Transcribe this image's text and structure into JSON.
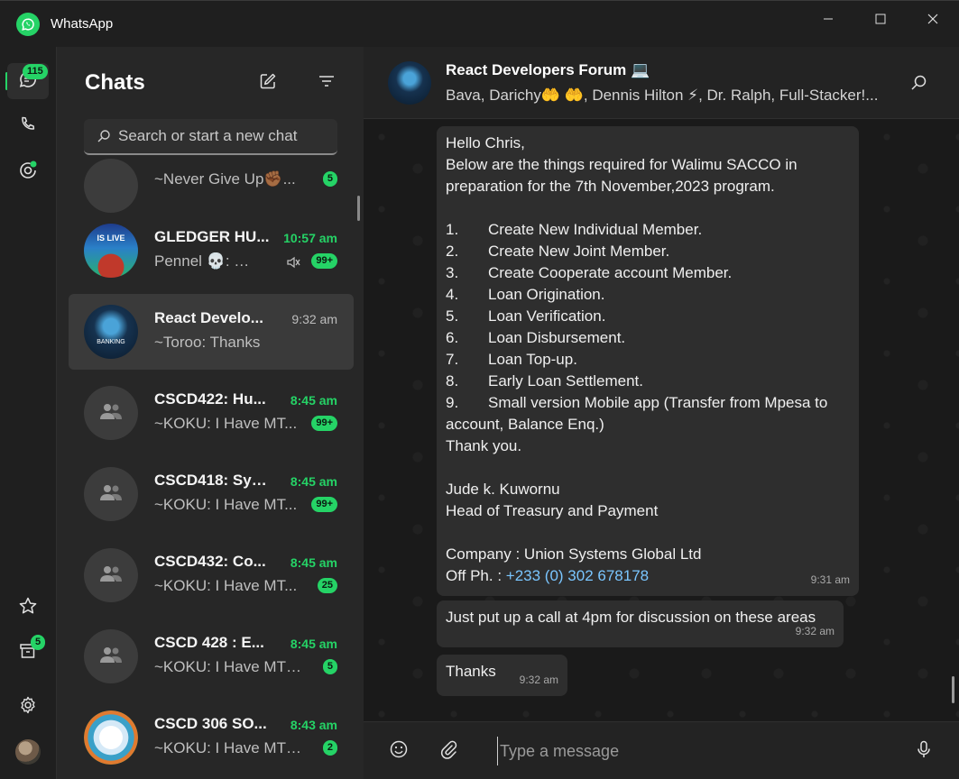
{
  "app": {
    "title": "WhatsApp"
  },
  "rail": {
    "chats_badge": "115",
    "archived_badge": "5"
  },
  "chatlist": {
    "title": "Chats",
    "search_placeholder": "Search or start a new chat",
    "items": [
      {
        "name": "",
        "time": "",
        "preview": "~Never Give Up✊🏾...",
        "badge": "5",
        "unread": true
      },
      {
        "name": "GLEDGER HU...",
        "time": "10:57 am",
        "preview": "Pennel 💀: 🫡...",
        "badge": "99+",
        "unread": true,
        "muted": true
      },
      {
        "name": "React Develo...",
        "time": "9:32 am",
        "preview": "~Toroo: Thanks",
        "badge": "",
        "unread": false
      },
      {
        "name": "CSCD422: Hu...",
        "time": "8:45 am",
        "preview": "~KOKU: I Have MT...",
        "badge": "99+",
        "unread": true
      },
      {
        "name": "CSCD418: Sys...",
        "time": "8:45 am",
        "preview": "~KOKU: I Have MT...",
        "badge": "99+",
        "unread": true
      },
      {
        "name": "CSCD432: Co...",
        "time": "8:45 am",
        "preview": "~KOKU: I Have MT...",
        "badge": "25",
        "unread": true
      },
      {
        "name": "CSCD 428 : E...",
        "time": "8:45 am",
        "preview": "~KOKU: I Have MTN,...",
        "badge": "5",
        "unread": true
      },
      {
        "name": "CSCD 306 SO...",
        "time": "8:43 am",
        "preview": "~KOKU: I Have MTN,...",
        "badge": "2",
        "unread": true
      }
    ],
    "avatar_texts": {
      "gledger": "IS LIVE",
      "react": "BANKING"
    }
  },
  "conversation": {
    "title": "React Developers Forum 💻",
    "subtitle": "Bava, Darichy🤲 🤲, Dennis Hilton ⚡, Dr. Ralph, Full-Stacker!...",
    "messages": [
      {
        "lines": [
          "Hello Chris,",
          "Below are the things required for Walimu SACCO in",
          "preparation for the 7th November,2023 program.",
          "",
          "1.|Create New Individual Member.",
          "2.|Create New Joint Member.",
          "3.|Create Cooperate account Member.",
          "4.|Loan Origination.",
          "5.|Loan Verification.",
          "6.|Loan Disbursement.",
          "7.|Loan Top-up.",
          "8.|Early Loan Settlement.",
          "9.|Small version Mobile app (Transfer from Mpesa to",
          "account, Balance Enq.)",
          "Thank you.",
          "",
          "Jude k. Kuwornu",
          "Head of Treasury and Payment",
          "",
          "Company : Union Systems Global Ltd"
        ],
        "phone_label": "Off Ph. : ",
        "phone": "+233 (0) 302 678178",
        "time": "9:31 am"
      },
      {
        "text": "Just put up a call at 4pm for discussion on these areas",
        "time": "9:32 am"
      },
      {
        "text": "Thanks",
        "time": "9:32 am"
      }
    ],
    "composer_placeholder": "Type a message"
  },
  "colors": {
    "accent": "#25d366",
    "link": "#7ac6ff"
  }
}
